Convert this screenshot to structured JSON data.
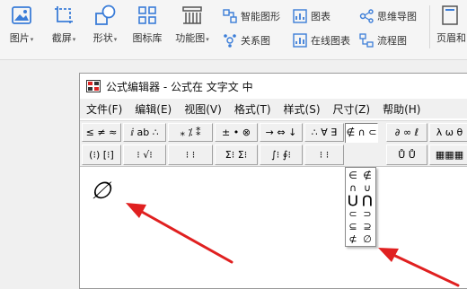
{
  "ribbon": {
    "buttons": [
      {
        "label": "图片",
        "has_arrow": true,
        "icon": "picture-icon"
      },
      {
        "label": "截屏",
        "has_arrow": true,
        "icon": "screenshot-icon"
      },
      {
        "label": "形状",
        "has_arrow": true,
        "icon": "shapes-icon"
      },
      {
        "label": "图标库",
        "has_arrow": false,
        "icon": "icon-library-icon"
      },
      {
        "label": "功能图",
        "has_arrow": true,
        "icon": "function-chart-icon"
      }
    ],
    "small_buttons": [
      {
        "label": "智能图形",
        "icon": "smart-art-icon"
      },
      {
        "label": "图表",
        "icon": "chart-icon"
      },
      {
        "label": "思维导图",
        "icon": "mind-map-icon"
      },
      {
        "label": "关系图",
        "icon": "relation-chart-icon"
      },
      {
        "label": "在线图表",
        "icon": "online-chart-icon"
      },
      {
        "label": "流程图",
        "icon": "flowchart-icon"
      }
    ],
    "right_button": {
      "label": "页眉和",
      "icon": "header-footer-icon"
    }
  },
  "editor": {
    "title": "公式编辑器 - 公式在 文字文 中",
    "menu": [
      "文件(F)",
      "编辑(E)",
      "视图(V)",
      "格式(T)",
      "样式(S)",
      "尺寸(Z)",
      "帮助(H)"
    ],
    "toolbar_row1": [
      "≤ ≠ ≈",
      "ⅈ ab ∴",
      "⁎ ⁒ ⁑",
      "± • ⊗",
      "→ ⇔ ↓",
      "∴ ∀ ∃",
      "∉ ∩ ⊂",
      "∂ ∞ ℓ",
      "λ ω θ"
    ],
    "toolbar_row2": [
      "(⁝) [⁝]",
      "⁝ √⁝",
      "⁝ ⁝",
      "Σ⁝ Σ⁝",
      "∫⁝ ∮⁝",
      "⁝ ⁝",
      "→ ←",
      "Ů Ů",
      "▦▦▦"
    ],
    "content": "∅",
    "palette": [
      [
        "∈",
        "∉"
      ],
      [
        "∩",
        "∪"
      ],
      [
        "⋃",
        "⋂"
      ],
      [
        "⊂",
        "⊃"
      ],
      [
        "⊆",
        "⊇"
      ],
      [
        "⊄",
        "∅"
      ]
    ]
  },
  "colors": {
    "arrow": "#e02020",
    "ribbon_bg": "#f5f5f5",
    "window_bg": "#ffffff",
    "toolbar_bg": "#f0f0f0"
  }
}
